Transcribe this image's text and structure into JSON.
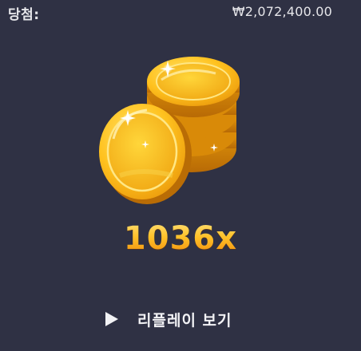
{
  "header": {
    "win_label": "당첨:",
    "win_amount": "₩2,072,400.00"
  },
  "result": {
    "multiplier": "1036x",
    "icon": "gold-coins-icon"
  },
  "replay": {
    "icon": "play-icon",
    "label": "리플레이 보기"
  },
  "colors": {
    "background": "#2f3144",
    "multiplier_gold": "#f6a518",
    "coin_gold": "#f2b21c"
  }
}
